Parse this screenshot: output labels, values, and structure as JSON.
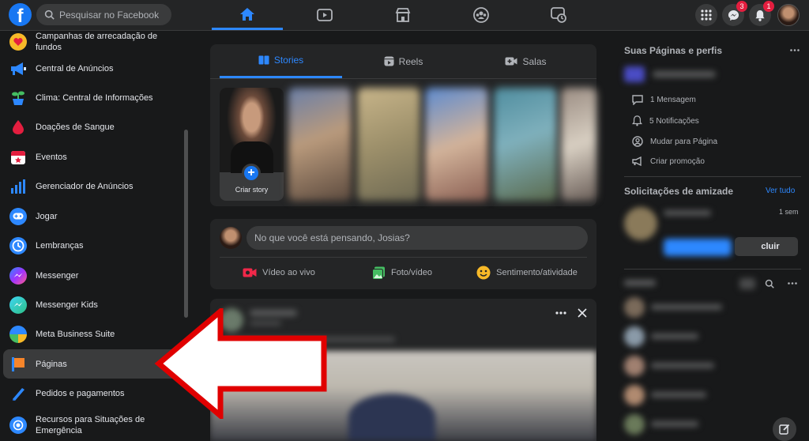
{
  "header": {
    "logo": "f",
    "search_placeholder": "Pesquisar no Facebook",
    "nav_tabs": [
      "home-icon",
      "video-icon",
      "marketplace-icon",
      "groups-icon",
      "gaming-icon"
    ],
    "messenger_badge": "3",
    "notifications_badge": "1"
  },
  "sidebar": {
    "items": [
      {
        "label": "Campanhas de arrecadação de fundos",
        "icon": "heart-icon"
      },
      {
        "label": "Central de Anúncios",
        "icon": "megaphone-icon"
      },
      {
        "label": "Clima: Central de Informações",
        "icon": "plant-icon"
      },
      {
        "label": "Doações de Sangue",
        "icon": "blood-drop-icon"
      },
      {
        "label": "Eventos",
        "icon": "calendar-icon"
      },
      {
        "label": "Gerenciador de Anúncios",
        "icon": "bar-chart-icon"
      },
      {
        "label": "Jogar",
        "icon": "gamepad-icon"
      },
      {
        "label": "Lembranças",
        "icon": "clock-icon"
      },
      {
        "label": "Messenger",
        "icon": "messenger-icon"
      },
      {
        "label": "Messenger Kids",
        "icon": "messenger-kids-icon"
      },
      {
        "label": "Meta Business Suite",
        "icon": "business-suite-icon"
      },
      {
        "label": "Páginas",
        "icon": "flag-icon"
      },
      {
        "label": "Pedidos e pagamentos",
        "icon": "payment-icon"
      },
      {
        "label": "Recursos para Situações de Emergência",
        "icon": "emergency-icon"
      }
    ]
  },
  "stories": {
    "tabs": [
      "Stories",
      "Reels",
      "Salas"
    ],
    "create_label": "Criar story"
  },
  "composer": {
    "placeholder": "No que você está pensando, Josias?",
    "actions": [
      "Vídeo ao vivo",
      "Foto/vídeo",
      "Sentimento/atividade"
    ]
  },
  "right": {
    "pages_title": "Suas Páginas e perfis",
    "page_actions": [
      "1 Mensagem",
      "5 Notificações",
      "Mudar para Página",
      "Criar promoção"
    ],
    "friend_requests_title": "Solicitações de amizade",
    "see_all": "Ver tudo",
    "request_time": "1 sem",
    "delete_label": "cluir"
  },
  "colors": {
    "accent": "#2d88ff",
    "background": "#18191a",
    "card": "#242526",
    "annotation_arrow": "#e00000"
  }
}
